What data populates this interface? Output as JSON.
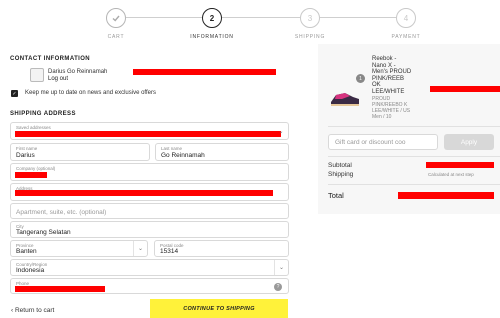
{
  "stepper": {
    "steps": [
      {
        "label": "CART",
        "icon": "check-icon",
        "number": ""
      },
      {
        "label": "INFORMATION",
        "icon": "",
        "number": "2"
      },
      {
        "label": "SHIPPING",
        "icon": "",
        "number": "3"
      },
      {
        "label": "PAYMENT",
        "icon": "",
        "number": "4"
      }
    ]
  },
  "contact": {
    "title": "CONTACT INFORMATION",
    "name": "Darius Go Reinnamah",
    "logout": "Log out",
    "newsletter": "Keep me up to date on news and exclusive offers"
  },
  "shipping": {
    "title": "SHIPPING ADDRESS",
    "saved_addresses_label": "Saved addresses",
    "first_name_label": "First name",
    "first_name_value": "Darius",
    "last_name_label": "Last name",
    "last_name_value": "Go Reinnamah",
    "company_label": "Company (optional)",
    "address_label": "Address",
    "apartment_placeholder": "Apartment, suite, etc. (optional)",
    "city_label": "City",
    "city_value": "Tangerang Selatan",
    "province_label": "Province",
    "province_value": "Banten",
    "postal_label": "Postal code",
    "postal_value": "15314",
    "country_label": "Country/Region",
    "country_value": "Indonesia",
    "phone_label": "Phone"
  },
  "footer": {
    "return_label": "‹ Return to cart",
    "continue_label": "CONTINUE TO SHIPPING"
  },
  "summary": {
    "product_name": "Reebok - Nano X - Men's PROUD PINK/REEB OK LEE/WHITE",
    "product_variant": "PROUD PINK/REEBO K LEE/WHITE / US Men / 10",
    "quantity": "1",
    "discount_placeholder": "Gift card or discount coo",
    "apply_label": "Apply",
    "subtotal_label": "Subtotal",
    "shipping_label": "Shipping",
    "shipping_value": "Calculated at next step",
    "total_label": "Total"
  },
  "colors": {
    "accent": "#fff23a",
    "redaction": "#ff0000"
  }
}
